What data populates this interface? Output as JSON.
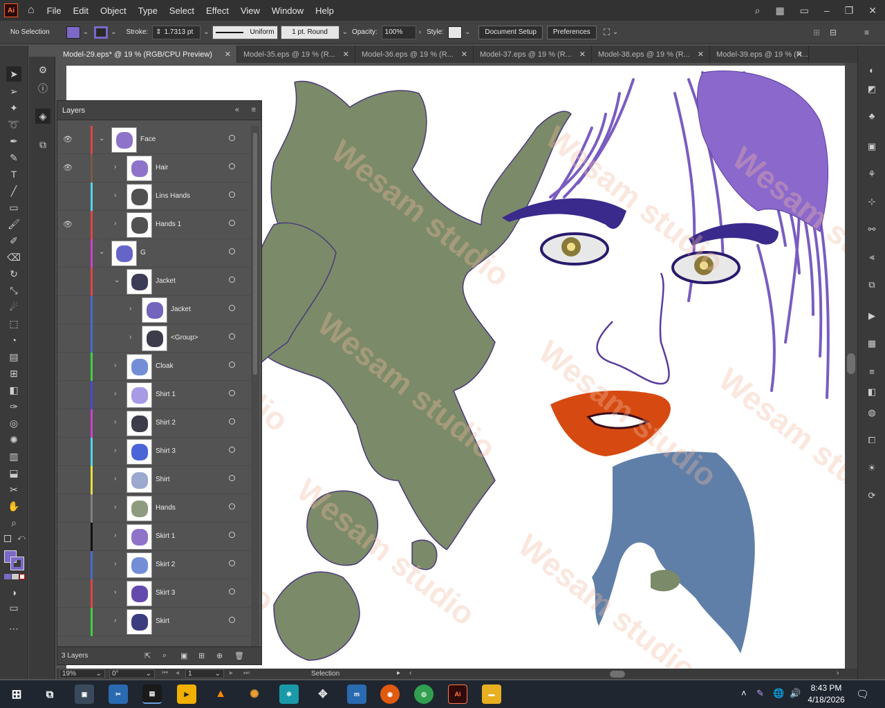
{
  "app": {
    "logo": "Ai"
  },
  "menu": [
    "File",
    "Edit",
    "Object",
    "Type",
    "Select",
    "Effect",
    "View",
    "Window",
    "Help"
  ],
  "control": {
    "selection": "No Selection",
    "fill_color": "#7b68c8",
    "stroke_color": "#3b2a8c",
    "stroke_label": "Stroke:",
    "stroke_value": "1.7313 pt",
    "profile": "Uniform",
    "brush": "1 pt. Round",
    "opacity_label": "Opacity:",
    "opacity_value": "100%",
    "style_label": "Style:",
    "doc_setup": "Document Setup",
    "preferences": "Preferences"
  },
  "tabs": [
    {
      "label": "Model-29.eps* @ 19 % (RGB/CPU Preview)",
      "active": true
    },
    {
      "label": "Model-35.eps @ 19 % (R..."
    },
    {
      "label": "Model-36.eps @ 19 % (R..."
    },
    {
      "label": "Model-37.eps @ 19 % (R..."
    },
    {
      "label": "Model-38.eps @ 19 % (R..."
    },
    {
      "label": "Model-39.eps @ 19 % (R..."
    }
  ],
  "tab_close_glyph": "✕",
  "layers_panel": {
    "title": "Layers",
    "count_label": "3 Layers",
    "rows": [
      {
        "name": "Face",
        "visible": true,
        "level": 0,
        "expanded": true,
        "color": "#e04545"
      },
      {
        "name": "Hair",
        "visible": true,
        "level": 1,
        "expanded": false,
        "color": "#7a5a4a"
      },
      {
        "name": "Lins Hands",
        "visible": false,
        "level": 1,
        "expanded": false,
        "color": "#4fd6e6"
      },
      {
        "name": "Hands 1",
        "visible": true,
        "level": 1,
        "expanded": false,
        "color": "#e04545"
      },
      {
        "name": "G",
        "visible": false,
        "level": 0,
        "expanded": true,
        "color": "#d040d0"
      },
      {
        "name": "Jacket",
        "visible": false,
        "level": 1,
        "expanded": true,
        "color": "#e04545"
      },
      {
        "name": "Jacket",
        "visible": false,
        "level": 2,
        "expanded": false,
        "color": "#4a6ad0"
      },
      {
        "name": "<Group>",
        "visible": false,
        "level": 2,
        "expanded": false,
        "color": "#4a6ad0"
      },
      {
        "name": "Cloak",
        "visible": false,
        "level": 1,
        "expanded": false,
        "color": "#40d040"
      },
      {
        "name": "Shirt 1",
        "visible": false,
        "level": 1,
        "expanded": false,
        "color": "#4a4ad0"
      },
      {
        "name": "Shirt 2",
        "visible": false,
        "level": 1,
        "expanded": false,
        "color": "#d040d0"
      },
      {
        "name": "Shirt 3",
        "visible": false,
        "level": 1,
        "expanded": false,
        "color": "#4fd6e6"
      },
      {
        "name": "Shirt",
        "visible": false,
        "level": 1,
        "expanded": false,
        "color": "#e6e040"
      },
      {
        "name": "Hands",
        "visible": false,
        "level": 1,
        "expanded": false,
        "color": "#808080"
      },
      {
        "name": "Skirt 1",
        "visible": false,
        "level": 1,
        "expanded": false,
        "color": "#111111"
      },
      {
        "name": "Skirt 2",
        "visible": false,
        "level": 1,
        "expanded": false,
        "color": "#4a6ad0"
      },
      {
        "name": "Skirt 3",
        "visible": false,
        "level": 1,
        "expanded": false,
        "color": "#e04545"
      },
      {
        "name": "Skirt",
        "visible": false,
        "level": 1,
        "expanded": false,
        "color": "#40d040"
      }
    ]
  },
  "status": {
    "zoom": "19%",
    "rotation": "0°",
    "artboard": "1",
    "tool": "Selection"
  },
  "taskbar": {
    "time": "8:43 PM",
    "date": "4/18/2026"
  },
  "watermark": "Wesam studio",
  "colors": {
    "artwork_green": "#7b8a68",
    "hair_purple": "#7a5cc0",
    "lip_orange": "#d64a12",
    "cloth_blue": "#5f7fa8"
  }
}
